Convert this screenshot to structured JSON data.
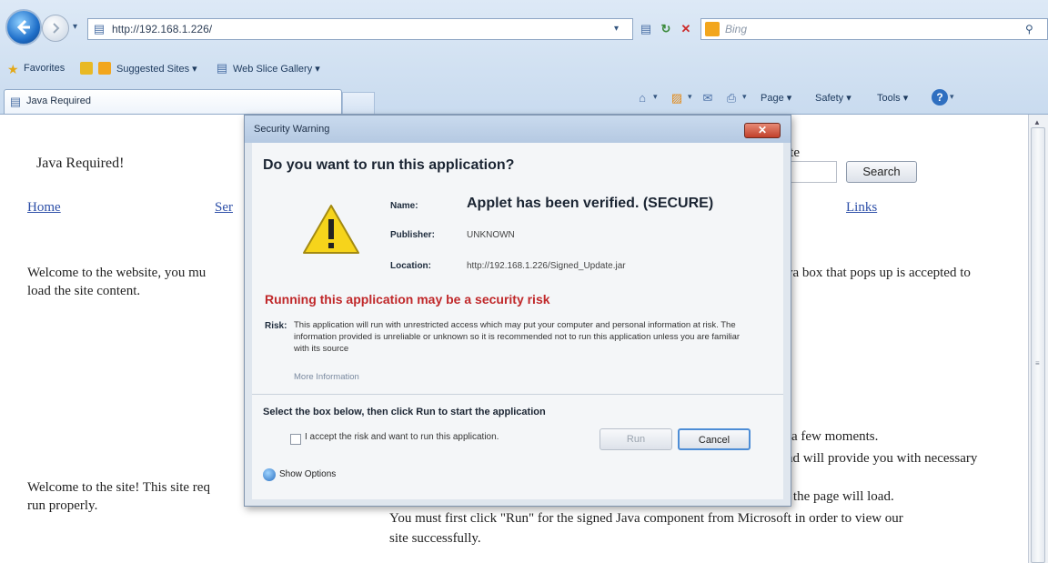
{
  "browser": {
    "url": "http://192.168.1.226/",
    "search_engine": "Bing",
    "tab_title": "Java Required",
    "favorites": {
      "favorites_label": "Favorites",
      "suggested_sites": "Suggested Sites ▾",
      "web_slice_gallery": "Web Slice Gallery ▾"
    },
    "command_bar": {
      "page": "Page ▾",
      "safety": "Safety ▾",
      "tools": "Tools ▾"
    }
  },
  "page": {
    "heading": "Java Required!",
    "search_partial": "ite",
    "search_button": "Search",
    "nav_home": "Home",
    "nav_partial": "Ser",
    "nav_links": "Links",
    "welcome_left_1": "Welcome to the website, you mu",
    "welcome_left_2": "load the site content.",
    "welcome_right_1": "va box that pops up is accepted to",
    "moments_1": "a few moments.",
    "moments_2": "nd will provide you with necessary",
    "site_req_1": "Welcome to the site! This site req",
    "site_req_2": "run properly.",
    "page_load": "l the page will load.",
    "bottom_1": "You must first click \"Run\" for the signed Java component from Microsoft in order to view our",
    "bottom_2": "site successfully."
  },
  "dialog": {
    "title": "Security Warning",
    "question": "Do you want to run this application?",
    "name_label": "Name:",
    "name_value": "Applet has been verified. (SECURE)",
    "publisher_label": "Publisher:",
    "publisher_value": "UNKNOWN",
    "location_label": "Location:",
    "location_value": "http://192.168.1.226/Signed_Update.jar",
    "risk_heading": "Running this application may be a security risk",
    "risk_label": "Risk:",
    "risk_text": "This application will run with unrestricted access which may put your computer and personal information at risk. The information provided is unreliable or unknown so it is recommended not to run this application unless you are familiar with its source",
    "more_info": "More Information",
    "instruction": "Select the box below, then click Run to start the application",
    "checkbox_label": "I accept the risk and want to run this application.",
    "run_button": "Run",
    "cancel_button": "Cancel",
    "show_options": "Show Options"
  },
  "colors": {
    "risk_red": "#c0282a",
    "link_blue": "#2d4fa8",
    "warning_yellow": "#f6d41b"
  },
  "icons": [
    "back-arrow-icon",
    "forward-arrow-icon",
    "page-icon",
    "refresh-icon",
    "stop-icon",
    "bing-icon",
    "search-icon",
    "star-icon",
    "add-favorite-icon",
    "home-icon",
    "feeds-icon",
    "mail-icon",
    "print-icon",
    "help-icon",
    "warning-icon",
    "shield-icon",
    "close-icon"
  ]
}
